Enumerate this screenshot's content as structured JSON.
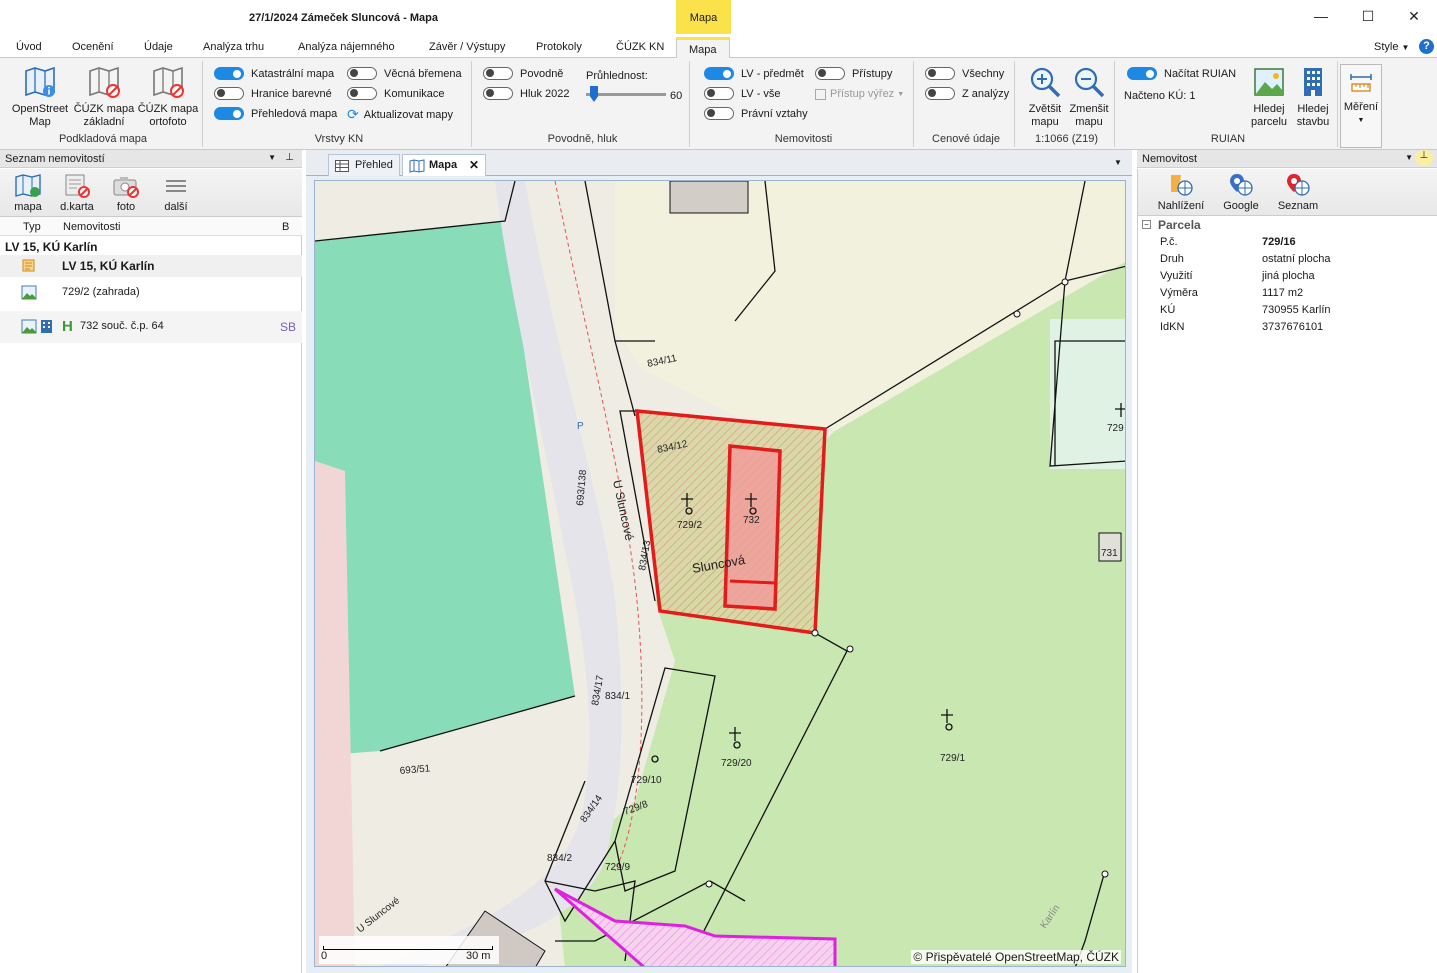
{
  "window": {
    "title": "27/1/2024  Zámeček Sluncová - Mapa",
    "context_tab": "Mapa",
    "controls": [
      "—",
      "☐",
      "✕"
    ]
  },
  "menu": {
    "tabs": [
      "Úvod",
      "Ocenění",
      "Údaje",
      "Analýza trhu",
      "Analýza nájemného",
      "Závěr / Výstupy",
      "Protokoly",
      "ČÚZK KN",
      "Mapa"
    ],
    "active": "Mapa",
    "style_label": "Style",
    "help": "?"
  },
  "ribbon": {
    "podkladova": {
      "label": "Podkladová mapa",
      "buttons": [
        {
          "label1": "OpenStreet",
          "label2": "Map",
          "icon": "map-info-icon"
        },
        {
          "label1": "ČÚZK mapa",
          "label2": "základní",
          "icon": "map-disabled-icon"
        },
        {
          "label1": "ČÚZK mapa",
          "label2": "ortofoto",
          "icon": "map-disabled-icon"
        }
      ]
    },
    "vrstvy": {
      "label": "Vrstvy KN",
      "toggles": [
        {
          "label": "Katastrální mapa",
          "on": true
        },
        {
          "label": "Hranice barevné",
          "on": false
        },
        {
          "label": "Přehledová mapa",
          "on": true
        },
        {
          "label": "Věcná břemena",
          "on": false
        },
        {
          "label": "Komunikace",
          "on": false
        }
      ],
      "refresh": "Aktualizovat mapy"
    },
    "povodne": {
      "label": "Povodně, hluk",
      "toggles": [
        {
          "label": "Povodně",
          "on": false
        },
        {
          "label": "Hluk 2022",
          "on": false
        }
      ],
      "opacity_label": "Průhlednost:",
      "opacity_value": "60",
      "opacity_fraction": 0.1
    },
    "nemovitosti": {
      "label": "Nemovitosti",
      "toggles": [
        {
          "label": "LV - předmět",
          "on": true
        },
        {
          "label": "LV - vše",
          "on": false
        },
        {
          "label": "Právní vztahy",
          "on": false
        },
        {
          "label": "Přístupy",
          "on": false
        }
      ],
      "pristup_vyrez": "Přístup výřez"
    },
    "cenove": {
      "label": "Cenové údaje",
      "toggles": [
        {
          "label": "Všechny",
          "on": false
        },
        {
          "label": "Z analýzy",
          "on": false
        }
      ]
    },
    "zoom": {
      "zoom_in": [
        "Zvětšit",
        "mapu"
      ],
      "zoom_out": [
        "Zmenšit",
        "mapu"
      ],
      "scale": "1:1066 (Z19)"
    },
    "ruian": {
      "label": "RUIAN",
      "toggle": {
        "label": "Načítat RUIAN",
        "on": true
      },
      "loaded": "Načteno KÚ:  1",
      "hledej_parcelu": [
        "Hledej",
        "parcelu"
      ],
      "hledej_stavbu": [
        "Hledej",
        "stavbu"
      ]
    },
    "mereni": "Měření"
  },
  "left_panel": {
    "title": "Seznam nemovitostí",
    "toolbar": [
      "mapa",
      "d.karta",
      "foto",
      "další"
    ],
    "columns": [
      "Typ",
      "Nemovitosti",
      "B"
    ],
    "group": "LV 15, KÚ Karlín",
    "rows": [
      {
        "text": "LV 15, KÚ Karlín",
        "bold": true
      },
      {
        "text": "729/2  (zahrada)"
      },
      {
        "text": "732  souč. č.p. 64",
        "badge": "SB"
      }
    ]
  },
  "map_tabs": [
    "Přehled",
    "Mapa"
  ],
  "map": {
    "labels": {
      "street1": "U Sluncové",
      "street2": "U Sluncové",
      "name": "Sluncová",
      "p834_11": "834/11",
      "p834_12": "834/12",
      "p834_13": "834/13",
      "p834_1": "834/1",
      "p834_17": "834/17",
      "p834_14": "834/14",
      "p834_2": "834/2",
      "p693_138": "693/138",
      "p693_51": "693/51",
      "p729_2": "729/2",
      "p732": "732",
      "p729_10": "729/10",
      "p729_20": "729/20",
      "p729_1": "729/1",
      "p729_8": "729/8",
      "p729_9": "729/9",
      "p729r": "729",
      "p731": "731",
      "karlin": "Karlín",
      "parking": "P"
    },
    "scale_start": "0",
    "scale_end": "30 m",
    "attribution": "© Přispěvatelé OpenStreetMap, ČÚZK"
  },
  "right_panel": {
    "title": "Nemovitost",
    "toolbar": [
      "Nahlížení",
      "Google",
      "Seznam"
    ],
    "section": "Parcela",
    "props": [
      {
        "k": "P.č.",
        "v": "729/16",
        "bold": true
      },
      {
        "k": "Druh",
        "v": "ostatní plocha"
      },
      {
        "k": "Využití",
        "v": "jiná plocha"
      },
      {
        "k": "Výměra",
        "v": "1117  m2"
      },
      {
        "k": "KÚ",
        "v": "730955  Karlín"
      },
      {
        "k": "IdKN",
        "v": "3737676101"
      }
    ]
  },
  "colors": {
    "accent": "#1e88e5",
    "context_yellow": "#fbe24a",
    "parcel_red": "#e31b1b",
    "magenta": "#e020e0",
    "green_area": "#c9e7b0",
    "park_green": "#88dcb8"
  }
}
